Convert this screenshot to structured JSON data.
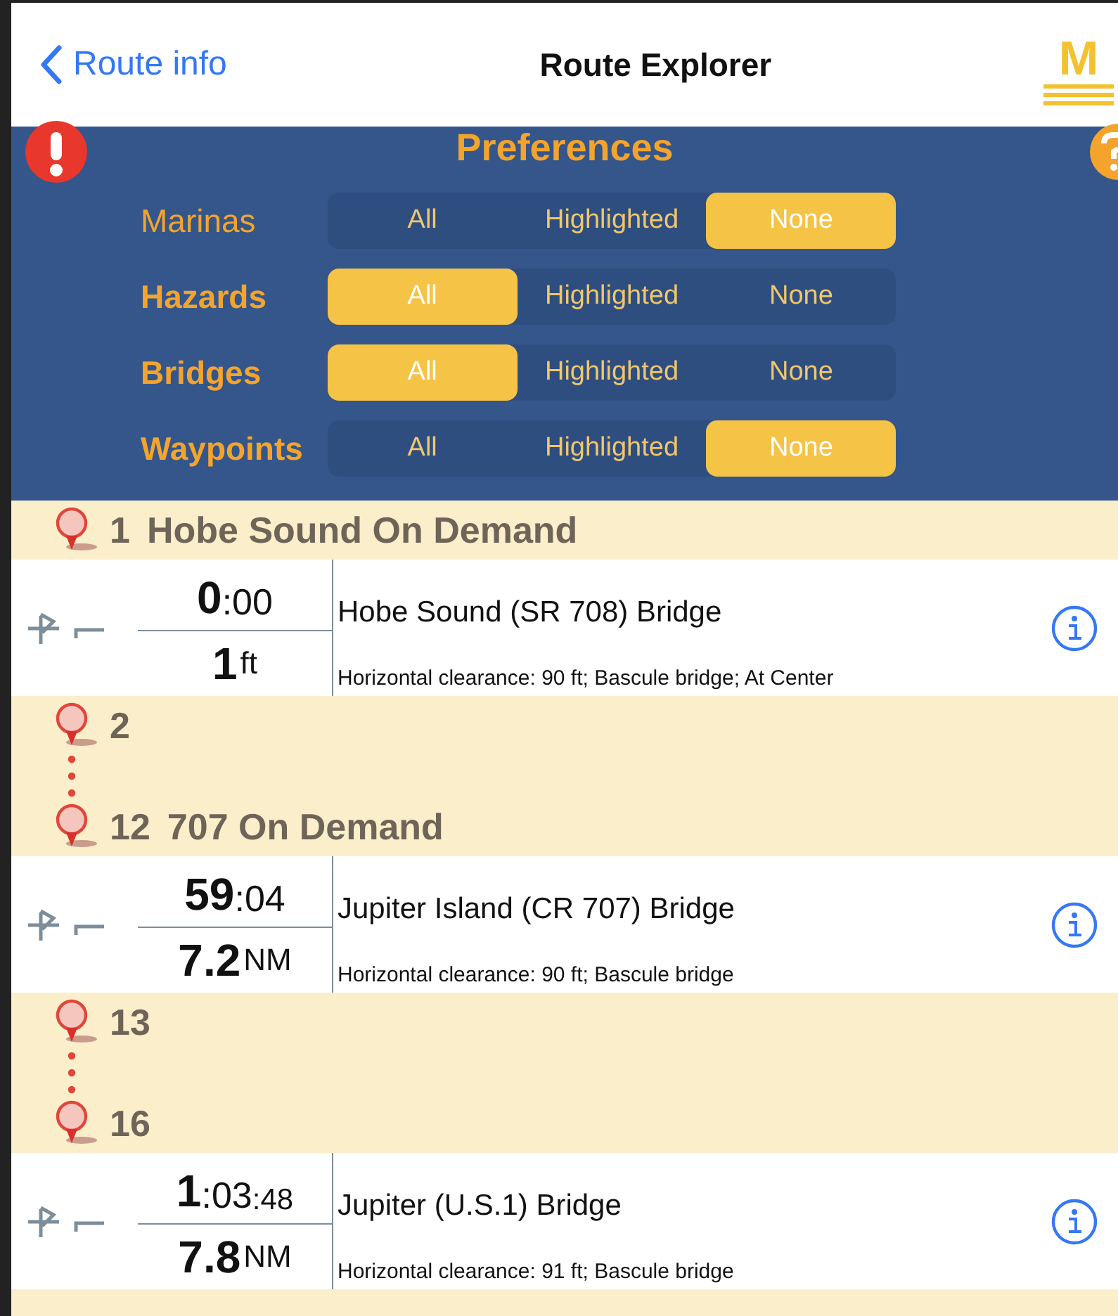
{
  "nav": {
    "back": "Route info",
    "title": "Route Explorer",
    "logo": "M"
  },
  "preferences": {
    "title": "Preferences",
    "rows": [
      {
        "label": "Marinas",
        "bold": false,
        "options": [
          {
            "label": "All",
            "selected": false
          },
          {
            "label": "Highlighted",
            "selected": false
          },
          {
            "label": "None",
            "selected": true
          }
        ]
      },
      {
        "label": "Hazards",
        "bold": true,
        "options": [
          {
            "label": "All",
            "selected": true
          },
          {
            "label": "Highlighted",
            "selected": false
          },
          {
            "label": "None",
            "selected": false
          }
        ]
      },
      {
        "label": "Bridges",
        "bold": true,
        "options": [
          {
            "label": "All",
            "selected": true
          },
          {
            "label": "Highlighted",
            "selected": false
          },
          {
            "label": "None",
            "selected": false
          }
        ]
      },
      {
        "label": "Waypoints",
        "bold": true,
        "options": [
          {
            "label": "All",
            "selected": false
          },
          {
            "label": "Highlighted",
            "selected": false
          },
          {
            "label": "None",
            "selected": true
          }
        ]
      }
    ]
  },
  "route": [
    {
      "kind": "waypoint",
      "number": "1",
      "name": "Hobe Sound On Demand"
    },
    {
      "kind": "bridge",
      "time_main": "0",
      "time_rest": ":00",
      "distance": "1",
      "unit": "ft",
      "name": "Hobe Sound (SR 708) Bridge",
      "detail": "Horizontal clearance: 90 ft; Bascule bridge; At Center"
    },
    {
      "kind": "waypoint",
      "number": "2"
    },
    {
      "kind": "dots"
    },
    {
      "kind": "waypoint",
      "number": "12",
      "name": "707 On Demand"
    },
    {
      "kind": "bridge",
      "time_main": "59",
      "time_rest": ":04",
      "distance": "7.2",
      "unit": "NM",
      "name": "Jupiter Island (CR 707) Bridge",
      "detail": "Horizontal clearance: 90 ft; Bascule bridge"
    },
    {
      "kind": "waypoint",
      "number": "13"
    },
    {
      "kind": "dots"
    },
    {
      "kind": "waypoint",
      "number": "16"
    },
    {
      "kind": "bridge",
      "time_main": "1",
      "time_rest": ":03",
      "time_tail": ":48",
      "distance": "7.8",
      "unit": "NM",
      "name": "Jupiter (U.S.1) Bridge",
      "detail": "Horizontal clearance: 91 ft; Bascule bridge"
    }
  ]
}
